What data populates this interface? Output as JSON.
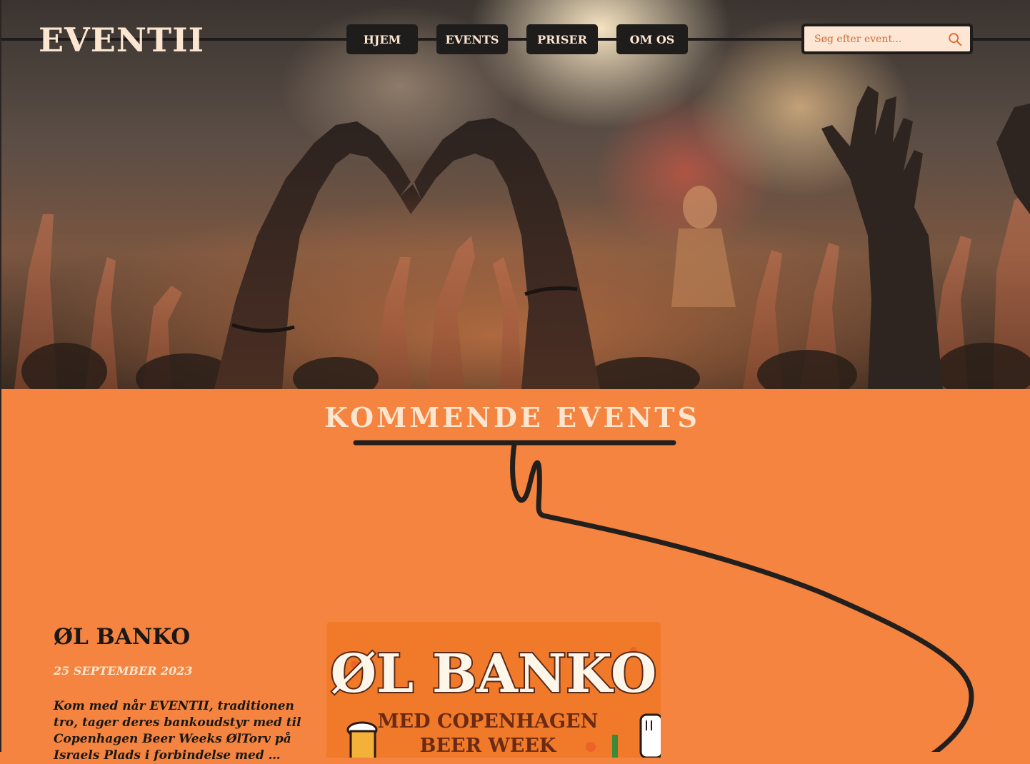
{
  "header": {
    "logo": "EVENTII",
    "nav": [
      {
        "label": "HJEM"
      },
      {
        "label": "EVENTS"
      },
      {
        "label": "PRISER"
      },
      {
        "label": "OM OS"
      }
    ],
    "search": {
      "placeholder": "Søg efter event...",
      "icon": "search-icon"
    }
  },
  "hero": {
    "image": "concert-crowd-heart-hands"
  },
  "events_section": {
    "title": "KOMMENDE EVENTS",
    "events": [
      {
        "title": "ØL BANKO",
        "date": "25 SEPTEMBER 2023",
        "description": "Kom med når EVENTII, traditionen tro, tager deres bankoudstyr med til Copenhagen Beer Weeks ØlTorv på Israels Plads i forbindelse med …",
        "poster": {
          "headline": "ØL BANKO",
          "subline_1": "MED COPENHAGEN",
          "subline_2": "BEER WEEK"
        }
      }
    ]
  },
  "colors": {
    "accent_orange": "#f4843f",
    "cream": "#fde6d0",
    "dark": "#1f1d1c"
  }
}
